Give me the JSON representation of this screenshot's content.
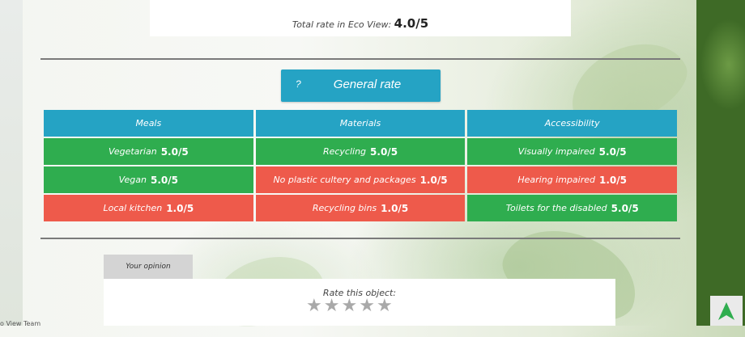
{
  "summary": {
    "total_label": "Total rate in Eco View:",
    "total_value": "4.0/5"
  },
  "general_rate": {
    "icon_text": "?",
    "label": "General rate"
  },
  "categories": [
    {
      "header": "Meals",
      "items": [
        {
          "label": "Vegetarian",
          "value": "5.0/5",
          "status": "good"
        },
        {
          "label": "Vegan",
          "value": "5.0/5",
          "status": "good"
        },
        {
          "label": "Local kitchen",
          "value": "1.0/5",
          "status": "bad"
        }
      ]
    },
    {
      "header": "Materials",
      "items": [
        {
          "label": "Recycling",
          "value": "5.0/5",
          "status": "good"
        },
        {
          "label": "No plastic cultery and packages",
          "value": "1.0/5",
          "status": "bad"
        },
        {
          "label": "Recycling bins",
          "value": "1.0/5",
          "status": "bad"
        }
      ]
    },
    {
      "header": "Accessibility",
      "items": [
        {
          "label": "Visually impaired",
          "value": "5.0/5",
          "status": "good"
        },
        {
          "label": "Hearing impaired",
          "value": "1.0/5",
          "status": "bad"
        },
        {
          "label": "Toilets for the disabled",
          "value": "5.0/5",
          "status": "good"
        }
      ]
    }
  ],
  "opinion": {
    "tab_label": "Your opinion",
    "rate_label": "Rate this object:",
    "stars": [
      "☆",
      "☆",
      "☆",
      "☆",
      "☆"
    ],
    "star_rating": 0
  },
  "footer": {
    "text": "o View Team"
  },
  "colors": {
    "header": "#25a3c4",
    "good": "#2fad4f",
    "bad": "#ee5a4b"
  },
  "icons": {
    "scroll_top": "arrow-up-icon",
    "star": "star-icon"
  }
}
